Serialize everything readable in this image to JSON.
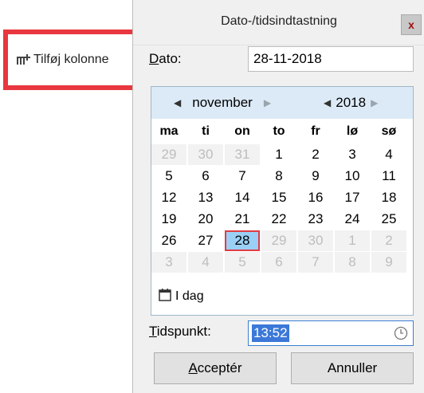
{
  "toolbar": {
    "add_column_label": "Tilføj kolonne"
  },
  "dialog": {
    "title": "Dato-/tidsindtastning",
    "close_label": "x",
    "date_label": "Dato:",
    "date_value": "28-11-2018",
    "calendar": {
      "month": "november",
      "year": "2018",
      "weekdays": [
        "ma",
        "ti",
        "on",
        "to",
        "fr",
        "lø",
        "sø"
      ],
      "weeks": [
        [
          "29",
          "30",
          "31",
          "1",
          "2",
          "3",
          "4"
        ],
        [
          "5",
          "6",
          "7",
          "8",
          "9",
          "10",
          "11"
        ],
        [
          "12",
          "13",
          "14",
          "15",
          "16",
          "17",
          "18"
        ],
        [
          "19",
          "20",
          "21",
          "22",
          "23",
          "24",
          "25"
        ],
        [
          "26",
          "27",
          "28",
          "29",
          "30",
          "1",
          "2"
        ],
        [
          "3",
          "4",
          "5",
          "6",
          "7",
          "8",
          "9"
        ]
      ],
      "today_label": "I dag"
    },
    "time_label": "Tidspunkt:",
    "time_value": "13:52",
    "accept_label": "Acceptér",
    "cancel_label": "Annuller",
    "colors": {
      "highlight": "#e8373f",
      "selected_day": "#9ad0f5",
      "header": "#dceaf7"
    }
  }
}
